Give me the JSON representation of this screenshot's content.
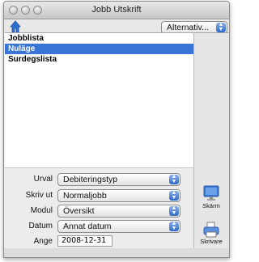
{
  "window": {
    "title": "Jobb Utskrift"
  },
  "toolbar": {
    "options_label": "Alternativ..."
  },
  "list": {
    "items": [
      {
        "label": "Jobblista",
        "selected": false
      },
      {
        "label": "Nuläge",
        "selected": true
      },
      {
        "label": "Surdegslista",
        "selected": false
      }
    ]
  },
  "form": {
    "urval": {
      "label": "Urval",
      "value": "Debiteringstyp"
    },
    "skriv_ut": {
      "label": "Skriv ut",
      "value": "Normaljobb"
    },
    "modul": {
      "label": "Modul",
      "value": "Översikt"
    },
    "datum": {
      "label": "Datum",
      "value": "Annat datum"
    },
    "ange": {
      "label": "Ange",
      "value": "2008-12-31"
    }
  },
  "actions": {
    "screen_label": "Skärm",
    "printer_label": "Skrivare"
  },
  "colors": {
    "selection": "#3875d7",
    "popup_arrow": "#2d69c9"
  },
  "icons": {
    "home": "home-icon",
    "screen": "monitor-icon",
    "printer": "printer-icon"
  }
}
